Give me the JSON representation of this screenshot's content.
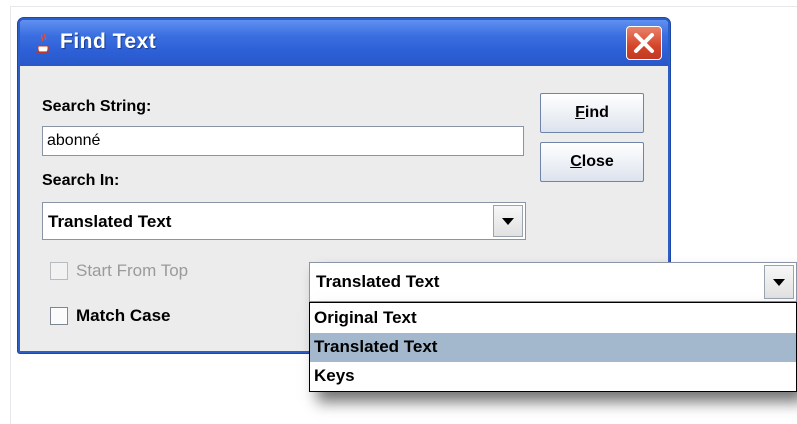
{
  "window": {
    "title": "Find Text",
    "title_icon": "java-cup-icon",
    "close_icon": "close-icon"
  },
  "form": {
    "search_string_label": "Search String:",
    "search_string_value": "abonné",
    "search_in_label": "Search In:",
    "search_in_value": "Translated Text",
    "start_from_top_label": "Start From Top",
    "start_from_top_checked": false,
    "start_from_top_enabled": false,
    "match_case_label": "Match Case",
    "match_case_checked": false
  },
  "buttons": {
    "find_prefix": "F",
    "find_rest": "ind",
    "close_prefix": "C",
    "close_rest": "lose"
  },
  "dropdown_popup": {
    "selected": "Translated Text",
    "options": [
      "Original Text",
      "Translated Text",
      "Keys"
    ],
    "highlighted_index": 1
  },
  "colors": {
    "titlebar": "#2c5fd6",
    "highlight": "#a3b8cc",
    "close_button": "#d4442a"
  }
}
